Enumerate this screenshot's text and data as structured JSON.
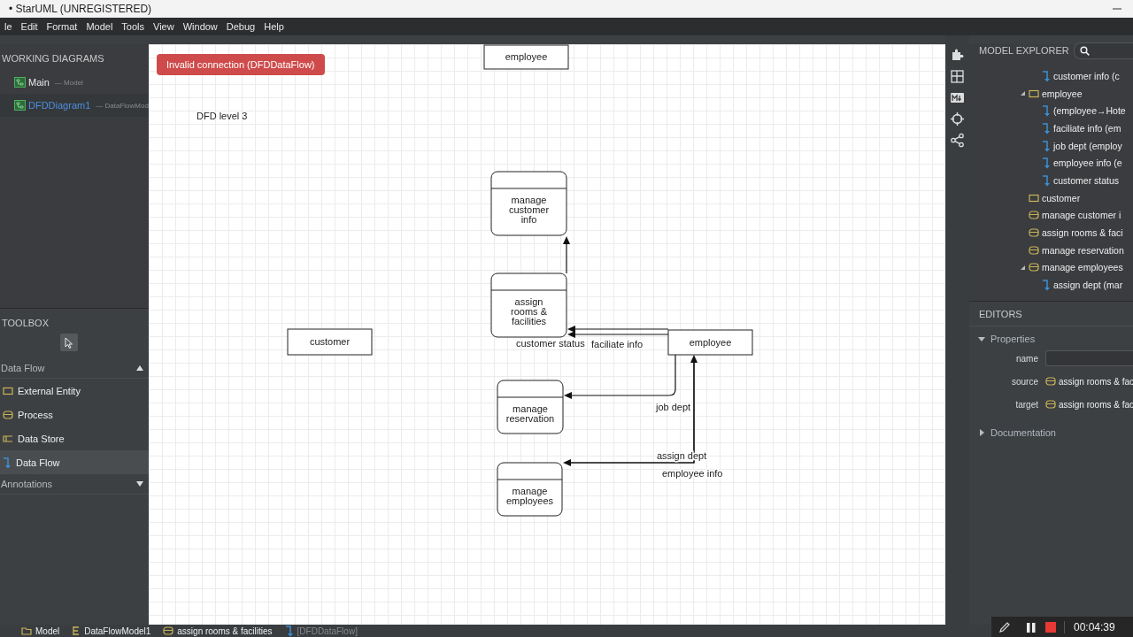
{
  "title_bar": {
    "title": "• StarUML (UNREGISTERED)"
  },
  "menu": [
    "le",
    "Edit",
    "Format",
    "Model",
    "Tools",
    "View",
    "Window",
    "Debug",
    "Help"
  ],
  "working_diagrams": {
    "title": "WORKING DIAGRAMS",
    "items": [
      {
        "name": "Main",
        "detail": "— Model",
        "selected": false
      },
      {
        "name": "DFDDiagram1",
        "detail": "— DataFlowMod",
        "selected": true
      }
    ]
  },
  "toolbox": {
    "title": "TOOLBOX",
    "sections": [
      {
        "title": "Data Flow",
        "expanded": true,
        "items": [
          {
            "label": "External Entity",
            "kind": "entity",
            "selected": false
          },
          {
            "label": "Process",
            "kind": "process",
            "selected": false
          },
          {
            "label": "Data Store",
            "kind": "store",
            "selected": false
          },
          {
            "label": "Data Flow",
            "kind": "flow",
            "selected": true
          }
        ]
      },
      {
        "title": "Annotations",
        "expanded": false
      }
    ]
  },
  "canvas": {
    "toast": "Invalid connection (DFDDataFlow)",
    "diagram_title": "DFD level 3",
    "nodes": [
      {
        "kind": "entity",
        "label": "employee"
      },
      {
        "kind": "process",
        "label": "manage customer info"
      },
      {
        "kind": "process",
        "label": "assign rooms & facilities"
      },
      {
        "kind": "entity",
        "label": "customer"
      },
      {
        "kind": "entity",
        "label": "employee"
      },
      {
        "kind": "process",
        "label": "manage reservation"
      },
      {
        "kind": "process",
        "label": "manage employees"
      }
    ],
    "flows": [
      {
        "kind": "labeled",
        "label": "customer status"
      },
      {
        "kind": "labeled",
        "label": "faciliate info"
      },
      {
        "kind": "labeled",
        "label": "job dept"
      },
      {
        "kind": "labeled",
        "label": "assign dept"
      },
      {
        "kind": "labeled",
        "label": "employee info"
      },
      {
        "kind": "unlabeled"
      }
    ]
  },
  "model_explorer": {
    "title": "MODEL EXPLORER",
    "continued_children": [
      {
        "kind": "flow",
        "label": "customer info (c"
      }
    ],
    "items": [
      {
        "kind": "entity",
        "label": "employee",
        "expanded": true,
        "children": [
          {
            "kind": "flow",
            "label": "(employee→Hote"
          },
          {
            "kind": "flow",
            "label": "faciliate info (em"
          },
          {
            "kind": "flow",
            "label": "job dept (employ"
          },
          {
            "kind": "flow",
            "label": "employee info (e"
          },
          {
            "kind": "flow",
            "label": "customer status"
          }
        ]
      },
      {
        "kind": "entity",
        "label": "customer"
      },
      {
        "kind": "process",
        "label": "manage customer i"
      },
      {
        "kind": "process",
        "label": "assign rooms & faci"
      },
      {
        "kind": "process",
        "label": "manage reservation"
      },
      {
        "kind": "process",
        "label": "manage employees",
        "expanded": true,
        "children": [
          {
            "kind": "flow",
            "label": "assign dept (mar"
          }
        ]
      }
    ]
  },
  "editors": {
    "title": "EDITORS",
    "properties": {
      "title": "Properties",
      "expanded": true,
      "fields": [
        {
          "label": "name",
          "kind": "input"
        },
        {
          "label": "source",
          "kind": "ref",
          "value": "assign rooms & fac"
        },
        {
          "label": "target",
          "kind": "ref",
          "value": "assign rooms & fac"
        }
      ]
    },
    "documentation": {
      "title": "Documentation",
      "expanded": false
    }
  },
  "status_bar": [
    {
      "kind": "model",
      "label": "Model",
      "disabled": false
    },
    {
      "kind": "datamodel",
      "label": "DataFlowModel1",
      "disabled": false
    },
    {
      "kind": "process",
      "label": "assign rooms & facilities",
      "disabled": false
    },
    {
      "kind": "flow",
      "label": "[DFDDataFlow]",
      "disabled": true
    }
  ],
  "recorder": {
    "time": "00:04:39"
  }
}
